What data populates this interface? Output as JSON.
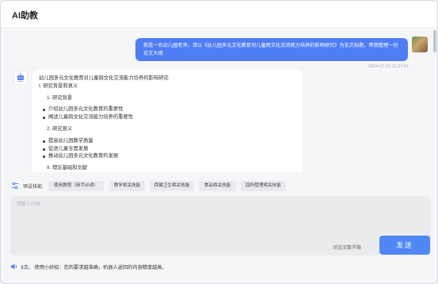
{
  "header": {
    "title": "AI助教"
  },
  "chat": {
    "user_message": "我是一名幼儿园老师，请以《幼儿园多元文化教育对儿童跨文化交流能力培养的影响研究》为论文标题，帮我整理一份论文大纲",
    "timestamp": "2024-07-23 11:27:41",
    "bot_lines": [
      "幼儿园多元文化教育对儿童跨文化交流能力培养的影响研究",
      "I. 研究背景和意义",
      "1. 研究背景",
      "介绍幼儿园多元文化教育的重要性",
      "阐述儿童跨文化交流能力培养的重要性",
      "2. 研究意义",
      "提高幼儿园教学质量",
      "促进儿童全面发展",
      "推动幼儿园多元文化教育的发展",
      "II. 理论基础和文献"
    ]
  },
  "presets": {
    "label": "预设技能:",
    "chips": [
      "使用教程（新手必读）",
      "教学相关技能",
      "保健卫生相关技能",
      "食品相关技能",
      "园所管理相关技能"
    ]
  },
  "input": {
    "placeholder": "请输入内容",
    "hint": "对话次数不限",
    "send_label": "发送"
  },
  "footer": {
    "text": "3次。 使用小妙招：您的要求越准确，机器人返回的内容精度越高。"
  },
  "colors": {
    "accent": "#4e7df4",
    "send": "#5187f5",
    "background": "#f5f6f8"
  },
  "icons": {
    "speaker": "speaker-icon",
    "preset": "sliders-icon",
    "bot": "robot-icon"
  }
}
